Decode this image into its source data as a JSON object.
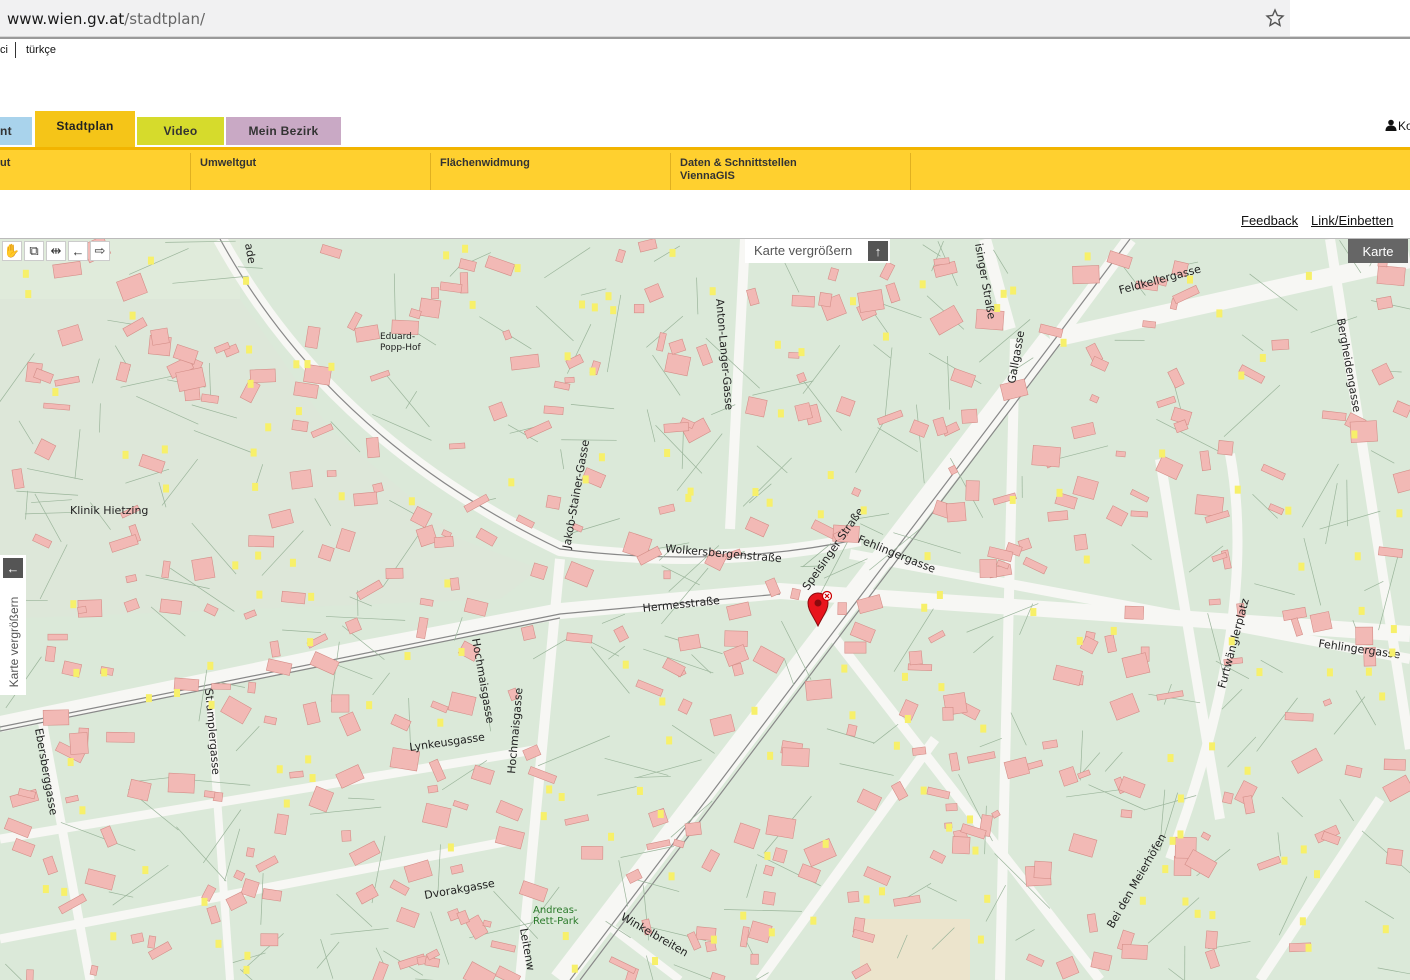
{
  "browser": {
    "url_domain": "www.wien.gv.at",
    "url_path": "/stadtplan/"
  },
  "languages": {
    "left_partial": "ci",
    "right": "türkçe"
  },
  "tabs": [
    {
      "label": "nt"
    },
    {
      "label": "Stadtplan"
    },
    {
      "label": "Video"
    },
    {
      "label": "Mein Bezirk"
    }
  ],
  "user": {
    "label": "Ko"
  },
  "subnav": [
    {
      "label": "ut"
    },
    {
      "label": "Umweltgut"
    },
    {
      "label": "Flächenwidmung"
    },
    {
      "label": "Daten & Schnittstellen",
      "label2": "ViennaGIS"
    }
  ],
  "links": {
    "feedback": "Feedback",
    "link_embed": "Link/Einbetten"
  },
  "map": {
    "enlarge_label": "Karte vergrößern",
    "karte_button": "Karte",
    "side_enlarge_label": "Karte vergrößern",
    "labels": {
      "klinik": "Klinik\nHietzing",
      "eduard": "Eduard-\nPopp-Hof",
      "anton": "Anton-Langer-Gasse",
      "jakob": "Jakob-Stainer-Gasse",
      "wolkersb": "Wolkersbergenstraße",
      "hermess": "Hermesstraße",
      "speising": "Speisinger Straße",
      "fehling": "Fehlingergasse",
      "fehling2": "Fehlingergasse",
      "feldkeller": "Feldkellergasse",
      "gallgasse": "Gallgasse",
      "bergheiden": "Bergheidengasse",
      "furtw": "Furtwänglerplatz",
      "hochmais1": "Hochmaisgasse",
      "hochmais2": "Hochmaisgasse",
      "lynkeus": "Lynkeusgasse",
      "dvorak": "Dvorakgasse",
      "eberberg": "Ebersberggasse",
      "strampfer": "Stramplergasse",
      "andreas": "Andreas-\nRett-Park",
      "winkelbreiten": "Winkelbreiten",
      "meierhof": "Bei den Meierhöfen",
      "leitenw": "Leitenw",
      "ade": "ade",
      "singer": "isinger Straße"
    },
    "tools": [
      "hand-tool",
      "zoom-box",
      "measure",
      "back",
      "forward"
    ]
  }
}
